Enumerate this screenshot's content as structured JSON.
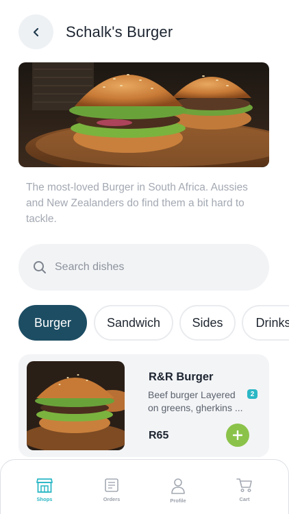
{
  "header": {
    "title": "Schalk's Burger",
    "back_icon": "chevron-left-icon"
  },
  "shop": {
    "description": "The most-loved Burger in South Africa. Aussies and New Zealanders do find them a bit hard to tackle."
  },
  "search": {
    "placeholder": "Search dishes",
    "value": "",
    "icon": "search-icon"
  },
  "categories": {
    "items": [
      "Burger",
      "Sandwich",
      "Sides",
      "Drinks"
    ],
    "selected": "Burger"
  },
  "dishes": [
    {
      "name": "R&R Burger",
      "description_line1": "Beef burger Layered",
      "description_line2": "on greens, gherkins ...",
      "badge": "2",
      "price": "R65"
    }
  ],
  "tabbar": {
    "tabs": [
      {
        "label": "Shops",
        "icon": "shop-icon"
      },
      {
        "label": "Orders",
        "icon": "orders-icon"
      },
      {
        "label": "Profile",
        "icon": "profile-icon"
      },
      {
        "label": "Cart",
        "icon": "cart-icon"
      }
    ],
    "active": "Shops"
  },
  "colors": {
    "accent_dark": "#1c4d63",
    "accent_teal": "#2bb7c5",
    "add_green": "#8bc34a",
    "muted_text": "#a3a8b2"
  }
}
